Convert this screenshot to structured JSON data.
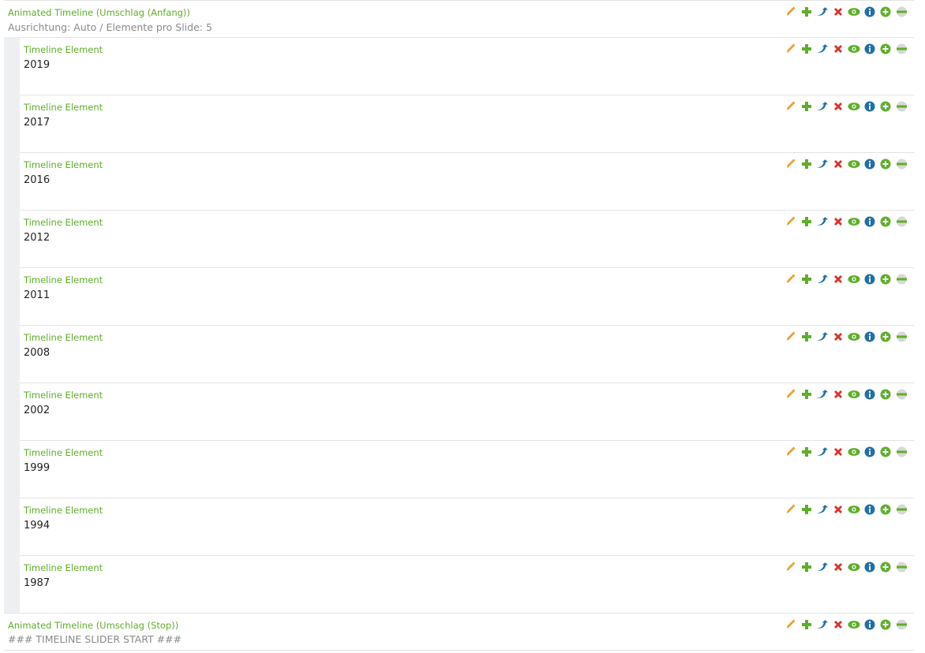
{
  "header": {
    "title": "Animated Timeline (Umschlag (Anfang))",
    "subtitle": "Ausrichtung: Auto / Elemente pro Slide: 5"
  },
  "elements": [
    {
      "title": "Timeline Element",
      "year": "2019"
    },
    {
      "title": "Timeline Element",
      "year": "2017"
    },
    {
      "title": "Timeline Element",
      "year": "2016"
    },
    {
      "title": "Timeline Element",
      "year": "2012"
    },
    {
      "title": "Timeline Element",
      "year": "2011"
    },
    {
      "title": "Timeline Element",
      "year": "2008"
    },
    {
      "title": "Timeline Element",
      "year": "2002"
    },
    {
      "title": "Timeline Element",
      "year": "1999"
    },
    {
      "title": "Timeline Element",
      "year": "1994"
    },
    {
      "title": "Timeline Element",
      "year": "1987"
    }
  ],
  "footer": {
    "title": "Animated Timeline (Umschlag (Stop))",
    "subtitle": "### TIMELINE SLIDER START ###"
  },
  "actions": [
    {
      "icon": "pencil-icon",
      "action": "edit"
    },
    {
      "icon": "plus-icon",
      "action": "add"
    },
    {
      "icon": "move-arrow-icon",
      "action": "move"
    },
    {
      "icon": "delete-x-icon",
      "action": "delete"
    },
    {
      "icon": "eye-icon",
      "action": "visibility"
    },
    {
      "icon": "info-icon",
      "action": "info"
    },
    {
      "icon": "plus-circle-icon",
      "action": "add-child"
    },
    {
      "icon": "collapse-icon",
      "action": "collapse"
    }
  ],
  "colors": {
    "title_green": "#5fae2a",
    "pencil": "#f0a030",
    "plus": "#5fae2a",
    "move": "#1f6fa8",
    "delete": "#d9332b",
    "eye": "#5fae2a",
    "info": "#1f6fa8",
    "collapse": "#5fae2a",
    "subtitle_gray": "#8a8a8a"
  }
}
